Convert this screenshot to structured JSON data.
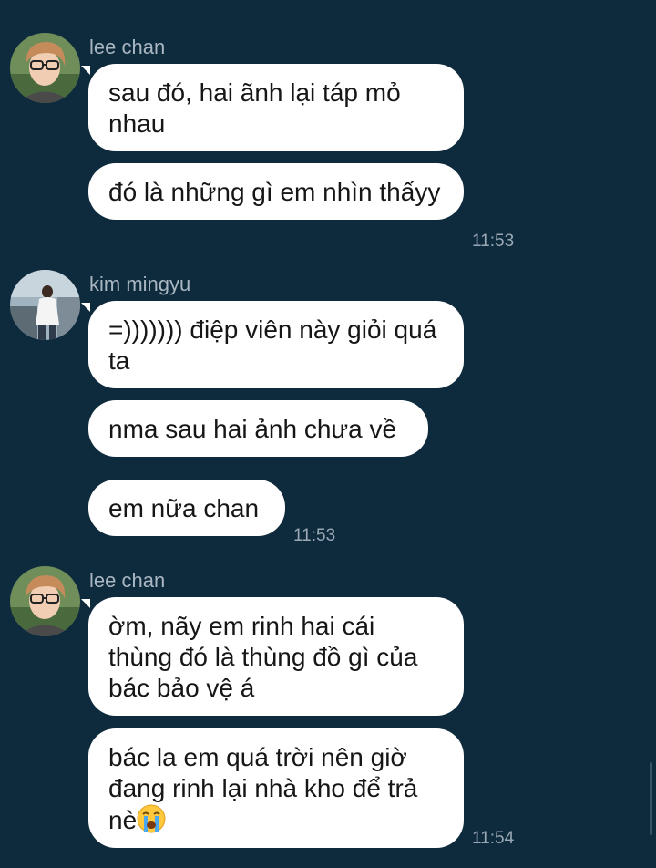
{
  "groups": [
    {
      "sender": "lee chan",
      "avatar": "lee-chan-avatar",
      "messages": [
        "sau đó, hai ãnh lại táp mỏ nhau",
        "đó là những gì em nhìn thấyy"
      ],
      "time": "11:53"
    },
    {
      "sender": "kim mingyu",
      "avatar": "kim-mingyu-avatar",
      "messages": [
        "=))))))) điệp viên này giỏi quá ta",
        "nma sau hai ảnh chưa về",
        "em nữa chan"
      ],
      "time": "11:53"
    },
    {
      "sender": "lee chan",
      "avatar": "lee-chan-avatar",
      "messages": [
        "ờm, nãy em rinh hai cái thùng đó là thùng đồ gì của bác bảo vệ á",
        "bác la em quá trời nên giờ đang rinh lại nhà kho để trả nè"
      ],
      "time": "11:54"
    }
  ],
  "icons": {
    "crying_emoji": "loudly-crying-face-emoji"
  },
  "colors": {
    "background": "#0e2a3d",
    "bubble": "#ffffff",
    "text": "#161616",
    "meta": "#a9b7c2"
  }
}
